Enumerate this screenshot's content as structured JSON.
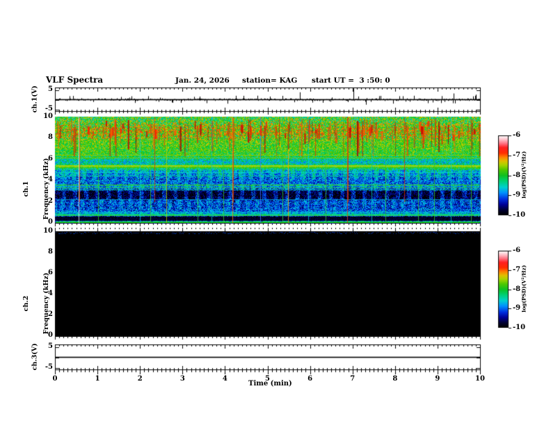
{
  "title": {
    "main": "VLF Spectra",
    "date": "Jan. 24, 2026",
    "station": "station= KAG",
    "start": "start UT =  3 :50: 0"
  },
  "labels": {
    "ch1v": "ch.1(V)",
    "ch1": "ch.1",
    "ch2": "ch.2",
    "freq": "Frequency (kHz)",
    "ch3v": "ch.3(V)",
    "time_axis": "Time (min)",
    "colorbar": "log(PSD)(V²/Hz)"
  },
  "axis_text": {
    "x_tick_labels": [
      "0",
      "1",
      "2",
      "3",
      "4",
      "5",
      "6",
      "7",
      "8",
      "9",
      "10"
    ],
    "freq_tick_labels": [
      "10",
      "8",
      "6",
      "4",
      "2",
      "0"
    ],
    "wave_tick_labels": [
      "5",
      "-5"
    ],
    "colorbar_tick_labels": [
      "-6",
      "-7",
      "-8",
      "-9",
      "-10"
    ]
  },
  "chart_data": {
    "type": "heatmap",
    "xlabel": "Time (min)",
    "xlim": [
      0,
      10
    ],
    "xticks": [
      0,
      1,
      2,
      3,
      4,
      5,
      6,
      7,
      8,
      9,
      10
    ],
    "seed": 1337,
    "colormap_stops": [
      [
        0.0,
        "#000000"
      ],
      [
        0.06,
        "#000030"
      ],
      [
        0.13,
        "#000096"
      ],
      [
        0.2,
        "#0030e0"
      ],
      [
        0.28,
        "#0090ff"
      ],
      [
        0.35,
        "#00d0d0"
      ],
      [
        0.43,
        "#00d070"
      ],
      [
        0.5,
        "#10c020"
      ],
      [
        0.57,
        "#50c800"
      ],
      [
        0.63,
        "#a8d400"
      ],
      [
        0.68,
        "#e0c000"
      ],
      [
        0.73,
        "#ff8000"
      ],
      [
        0.78,
        "#ff3000"
      ],
      [
        0.85,
        "#ff2020"
      ],
      [
        0.9,
        "#ff7080"
      ],
      [
        0.95,
        "#ffc0c8"
      ],
      [
        1.0,
        "#ffffff"
      ]
    ],
    "panels": [
      {
        "id": "ch1_waveform",
        "ylabel": "ch.1(V)",
        "ylim": [
          -6.5,
          6.5
        ],
        "yticks": [
          5,
          -5
        ],
        "baseline_V": 0,
        "noise_V": 0.35,
        "spikes_min_V": [
          [
            0.35,
            0.9
          ],
          [
            0.9,
            -0.6
          ],
          [
            1.55,
            0.7
          ],
          [
            2.2,
            0.9
          ],
          [
            2.75,
            -0.7
          ],
          [
            3.4,
            0.8
          ],
          [
            4.25,
            1.0
          ],
          [
            5.05,
            0.8
          ],
          [
            5.76,
            1.9
          ],
          [
            6.3,
            -0.8
          ],
          [
            7.02,
            2.9
          ],
          [
            7.31,
            -1.3
          ],
          [
            8.1,
            0.9
          ],
          [
            8.77,
            -0.9
          ],
          [
            9.37,
            1.6
          ],
          [
            9.9,
            1.3
          ]
        ]
      },
      {
        "id": "ch1_spectrogram",
        "ylabel": "ch.1 Frequency (kHz)",
        "ylim": [
          0,
          10
        ],
        "yticks": [
          0,
          2,
          4,
          6,
          8,
          10
        ],
        "colorbar": {
          "label": "log(PSD)(V²/Hz)",
          "ticks": [
            -6,
            -7,
            -8,
            -9,
            -10
          ]
        },
        "profile_kHz_level": [
          [
            0,
            0.03
          ],
          [
            0.12,
            0.03
          ],
          [
            0.16,
            0.62
          ],
          [
            0.22,
            0.05
          ],
          [
            0.6,
            0.04
          ],
          [
            0.75,
            0.42
          ],
          [
            0.95,
            0.3
          ],
          [
            1.1,
            0.25
          ],
          [
            1.5,
            0.22
          ],
          [
            2.0,
            0.24
          ],
          [
            2.35,
            0.15
          ],
          [
            2.5,
            0.12
          ],
          [
            3.0,
            0.13
          ],
          [
            3.3,
            0.3
          ],
          [
            3.6,
            0.34
          ],
          [
            3.8,
            0.24
          ],
          [
            4.2,
            0.28
          ],
          [
            4.6,
            0.33
          ],
          [
            5.0,
            0.38
          ],
          [
            5.3,
            0.5
          ],
          [
            5.5,
            0.44
          ],
          [
            5.7,
            0.35
          ],
          [
            6.0,
            0.4
          ],
          [
            6.3,
            0.48
          ],
          [
            6.6,
            0.52
          ],
          [
            7.0,
            0.54
          ],
          [
            7.6,
            0.55
          ],
          [
            8.0,
            0.58
          ],
          [
            8.6,
            0.62
          ],
          [
            9.2,
            0.58
          ],
          [
            9.6,
            0.54
          ],
          [
            10,
            0.52
          ]
        ],
        "hlines_kHz": [
          [
            6.4,
            "#a0c800",
            1
          ],
          [
            6.12,
            "#86c800",
            1
          ],
          [
            5.45,
            "#b8d400",
            2
          ],
          [
            5.22,
            "#58c800",
            1
          ],
          [
            4.78,
            "#00d2c8",
            1
          ],
          [
            4.45,
            "#00c896",
            1
          ],
          [
            3.62,
            "#46c800",
            1
          ],
          [
            3.36,
            "#2fb84b",
            1
          ],
          [
            3.14,
            "#00b48c",
            1
          ],
          [
            2.2,
            "#00a0c8",
            1
          ],
          [
            1.02,
            "#00c8c8",
            1
          ],
          [
            0.86,
            "#00d284",
            1
          ],
          [
            0.7,
            "#3cd23c",
            1
          ],
          [
            0.16,
            "#1ee11e",
            2
          ]
        ],
        "vlines_min": [
          [
            0.56,
            "#e8ffe8"
          ],
          [
            1.02,
            "#30d030"
          ],
          [
            1.99,
            "#00c8d2"
          ],
          [
            2.24,
            "#38c838"
          ],
          [
            2.62,
            "#b0d000"
          ],
          [
            3.35,
            "#2fc82f"
          ],
          [
            3.68,
            "#00becd"
          ],
          [
            3.96,
            "#35c835"
          ],
          [
            4.17,
            "#ff7800"
          ],
          [
            4.82,
            "#3c78ff"
          ],
          [
            5.35,
            "#2fc82f"
          ],
          [
            5.49,
            "#ffa000"
          ],
          [
            5.96,
            "#00c8c8"
          ],
          [
            6.37,
            "#35c835"
          ],
          [
            6.87,
            "#e04010"
          ],
          [
            7.45,
            "#00c8b4"
          ],
          [
            7.78,
            "#2fc82f"
          ],
          [
            8.55,
            "#35c835"
          ],
          [
            8.92,
            "#2fc82f"
          ],
          [
            9.32,
            "#00c8c8"
          ],
          [
            9.78,
            "#35c835"
          ]
        ],
        "deep_red_lines_min": [
          0.56,
          2.33,
          4.17,
          6.87,
          8.2
        ],
        "block_bands": [
          {
            "f0": 2.25,
            "f1": 3.05,
            "p": 16,
            "duty": 0.62,
            "d": -0.11
          },
          {
            "f0": 3.05,
            "f1": 3.75,
            "p": 16,
            "duty": 0.6,
            "d": -0.05
          },
          {
            "f0": 4.1,
            "f1": 5.0,
            "p": 15,
            "duty": 0.6,
            "d": -0.07
          },
          {
            "f0": 1.35,
            "f1": 2.3,
            "p": 14,
            "duty": 0.55,
            "d": -0.04
          }
        ],
        "red_streaks": {
          "count": 110,
          "f_top_min": 9.0,
          "f_top_max": 9.8,
          "f_bot_min": 6.6,
          "f_bot_max": 8.6,
          "palette": [
            "#c80000",
            "#e42800",
            "#ff3c00",
            "#a00000",
            "#ff6400"
          ]
        },
        "red_blobs": {
          "count": 55,
          "f_min": 8.2,
          "f_max": 9.6,
          "palette": [
            "#ff1e00",
            "#d20000",
            "#ff5a00"
          ]
        }
      },
      {
        "id": "ch2_spectrogram",
        "ylabel": "ch.2 Frequency (kHz)",
        "ylim": [
          0,
          10
        ],
        "yticks": [
          0,
          2,
          4,
          6,
          8,
          10
        ],
        "colorbar": {
          "label": "log(PSD)(V²/Hz)",
          "ticks": [
            -6,
            -7,
            -8,
            -9,
            -10
          ]
        },
        "fill": "#000000",
        "note_top_speckle": "#0030a0"
      },
      {
        "id": "ch3_waveform",
        "ylabel": "ch.3(V)",
        "ylim": [
          -6.5,
          6.5
        ],
        "yticks": [
          5,
          -5
        ],
        "baseline_V": 0,
        "noise_V": 0,
        "spikes_min_V": []
      }
    ]
  }
}
